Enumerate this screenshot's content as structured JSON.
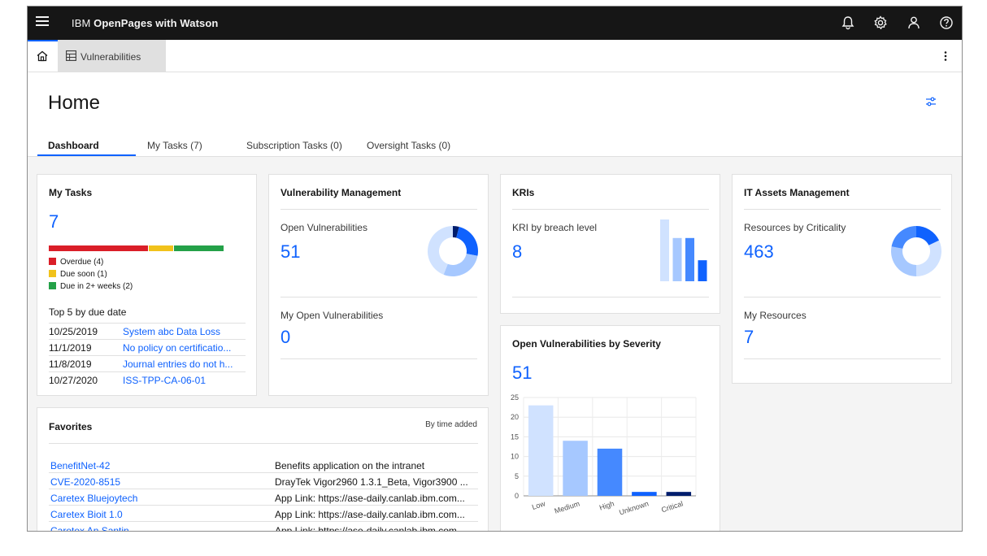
{
  "app": {
    "title_prefix": "IBM ",
    "title_bold": "OpenPages with Watson"
  },
  "tabstrip": {
    "vuln_tab_label": "Vulnerabilities"
  },
  "page": {
    "title": "Home",
    "tabs": [
      {
        "label": "Dashboard"
      },
      {
        "label": "My Tasks (7)"
      },
      {
        "label": "Subscription Tasks (0)"
      },
      {
        "label": "Oversight Tasks (0)"
      }
    ]
  },
  "my_tasks": {
    "title": "My Tasks",
    "count": "7",
    "bar": [
      {
        "value": 4,
        "color": "#da1e28"
      },
      {
        "value": 1,
        "color": "#f1c21b"
      },
      {
        "value": 2,
        "color": "#24a148"
      }
    ],
    "legend": [
      {
        "label": "Overdue (4)",
        "color": "#da1e28"
      },
      {
        "label": "Due soon (1)",
        "color": "#f1c21b"
      },
      {
        "label": "Due in 2+ weeks (2)",
        "color": "#24a148"
      }
    ],
    "top5_label": "Top 5 by due date",
    "rows": [
      {
        "date": "10/25/2019",
        "name": "System abc Data Loss"
      },
      {
        "date": "11/1/2019",
        "name": "No policy on certificatio..."
      },
      {
        "date": "11/8/2019",
        "name": "Journal entries do not h..."
      },
      {
        "date": "10/27/2020",
        "name": "ISS-TPP-CA-06-01"
      }
    ]
  },
  "vuln_mgmt": {
    "title": "Vulnerability Management",
    "open_label": "Open Vulnerabilities",
    "open_value": "51",
    "my_open_label": "My Open Vulnerabilities",
    "my_open_value": "0",
    "donut": [
      {
        "value": 4,
        "color": "#001d6c"
      },
      {
        "value": 24,
        "color": "#0f62fe"
      },
      {
        "value": 28,
        "color": "#a6c8ff"
      },
      {
        "value": 44,
        "color": "#d0e2ff"
      }
    ]
  },
  "kris": {
    "title": "KRIs",
    "label": "KRI by breach level",
    "value": "8",
    "bars": [
      {
        "value": 5,
        "color": "#d0e2ff"
      },
      {
        "value": 3.5,
        "color": "#a6c8ff"
      },
      {
        "value": 3.5,
        "color": "#4589ff"
      },
      {
        "value": 1.7,
        "color": "#0f62fe"
      }
    ]
  },
  "it_assets": {
    "title": "IT Assets Management",
    "resources_label": "Resources by Criticality",
    "resources_value": "463",
    "my_resources_label": "My Resources",
    "my_resources_value": "7",
    "donut": [
      {
        "value": 18,
        "color": "#0f62fe"
      },
      {
        "value": 32,
        "color": "#d0e2ff"
      },
      {
        "value": 28,
        "color": "#a6c8ff"
      },
      {
        "value": 22,
        "color": "#4589ff"
      }
    ]
  },
  "favorites": {
    "title": "Favorites",
    "sort_label": "By time added",
    "rows": [
      {
        "name": "BenefitNet-42",
        "desc": "Benefits application on the intranet"
      },
      {
        "name": "CVE-2020-8515",
        "desc": "DrayTek Vigor2960 1.3.1_Beta, Vigor3900 ..."
      },
      {
        "name": "Caretex Bluejoytech",
        "desc": "App Link: https://ase-daily.canlab.ibm.com..."
      },
      {
        "name": "Caretex Bioit 1.0",
        "desc": "App Link: https://ase-daily.canlab.ibm.com..."
      },
      {
        "name": "Caretex An Santin",
        "desc": "App Link: https://ase-daily.canlab.ibm.com..."
      }
    ]
  },
  "severity": {
    "title": "Open Vulnerabilities by Severity",
    "value": "51"
  },
  "chart_data": {
    "type": "bar",
    "categories": [
      "Low",
      "Medium",
      "High",
      "Unknown",
      "Critical"
    ],
    "values": [
      23,
      14,
      12,
      1,
      1
    ],
    "colors": [
      "#d0e2ff",
      "#a6c8ff",
      "#4589ff",
      "#0f62fe",
      "#001d6c"
    ],
    "ylim": [
      0,
      25
    ],
    "yticks": [
      0,
      5,
      10,
      15,
      20,
      25
    ],
    "grid": true
  }
}
